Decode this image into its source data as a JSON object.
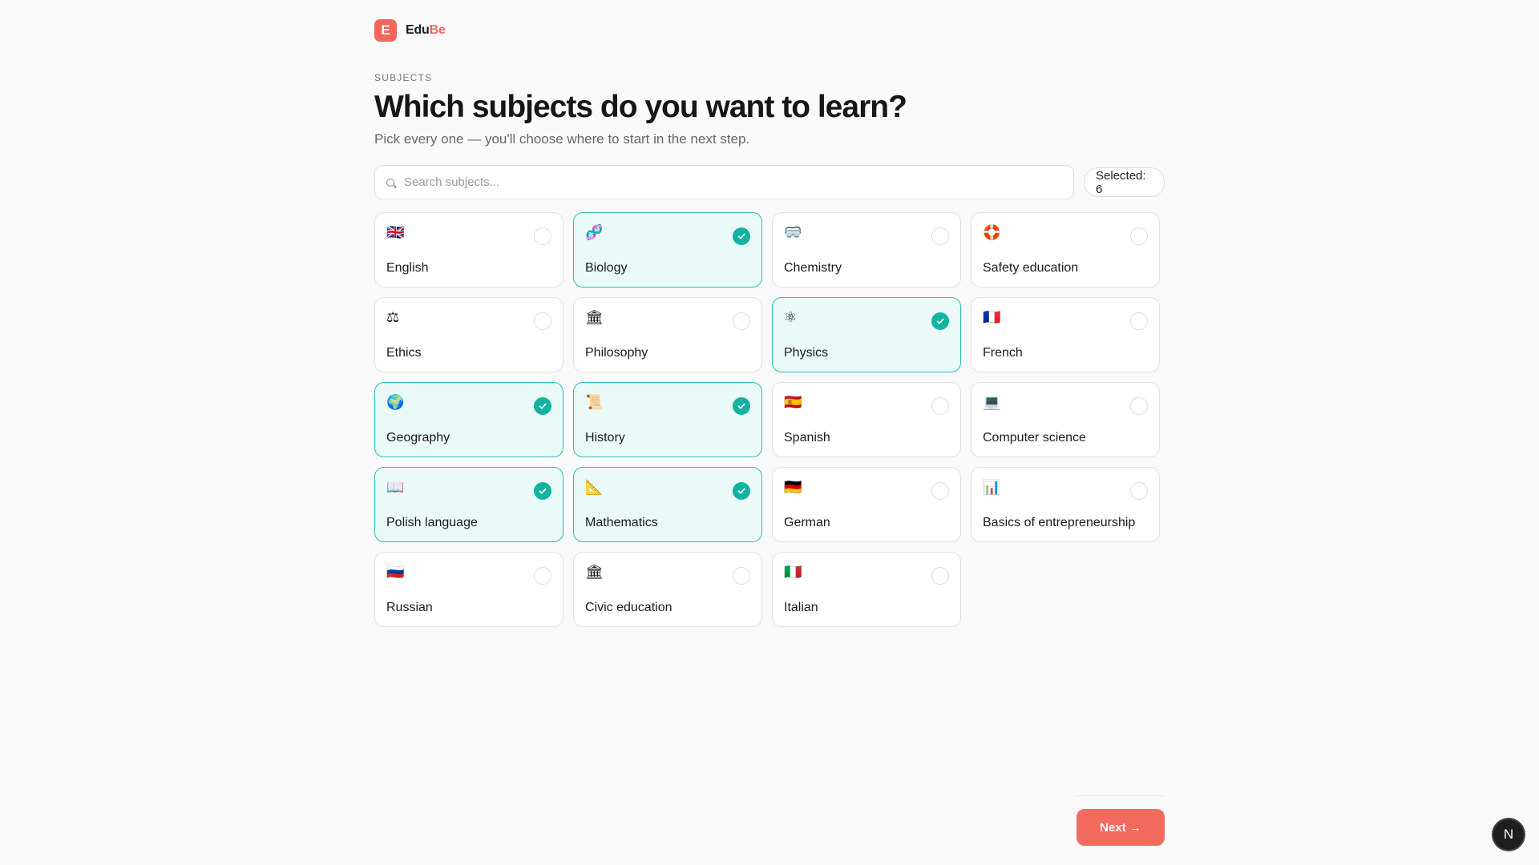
{
  "brand": {
    "logo_letter": "E",
    "name_main": "Edu",
    "name_accent": "Be",
    "accent_color": "#f0665a"
  },
  "header": {
    "eyebrow": "SUBJECTS",
    "title": "Which subjects do you want to learn?",
    "subtitle": "Pick every one — you'll choose where to start in the next step."
  },
  "search": {
    "placeholder": "Search subjects...",
    "value": "",
    "icon": "search-icon"
  },
  "selected_count": "Selected: 6",
  "subjects": [
    {
      "label": "English",
      "icon": "🇬🇧",
      "icon_name": "uk-flag-icon",
      "selected": false
    },
    {
      "label": "Biology",
      "icon": "🧬",
      "icon_name": "dna-icon",
      "selected": true
    },
    {
      "label": "Chemistry",
      "icon": "🥽",
      "icon_name": "goggles-icon",
      "selected": false
    },
    {
      "label": "Safety education",
      "icon": "🛟",
      "icon_name": "lifebuoy-icon",
      "selected": false
    },
    {
      "label": "Ethics",
      "icon": "⚖",
      "icon_name": "scales-icon",
      "selected": false
    },
    {
      "label": "Philosophy",
      "icon": "🏛",
      "icon_name": "classical-building-icon",
      "selected": false
    },
    {
      "label": "Physics",
      "icon": "⚛",
      "icon_name": "atom-icon",
      "selected": true
    },
    {
      "label": "French",
      "icon": "🇫🇷",
      "icon_name": "france-flag-icon",
      "selected": false
    },
    {
      "label": "Geography",
      "icon": "🌍",
      "icon_name": "globe-icon",
      "selected": true
    },
    {
      "label": "History",
      "icon": "📜",
      "icon_name": "scroll-icon",
      "selected": true
    },
    {
      "label": "Spanish",
      "icon": "🇪🇸",
      "icon_name": "spain-flag-icon",
      "selected": false
    },
    {
      "label": "Computer science",
      "icon": "💻",
      "icon_name": "laptop-icon",
      "selected": false
    },
    {
      "label": "Polish language",
      "icon": "📖",
      "icon_name": "open-book-icon",
      "selected": true
    },
    {
      "label": "Mathematics",
      "icon": "📐",
      "icon_name": "triangle-ruler-icon",
      "selected": true
    },
    {
      "label": "German",
      "icon": "🇩🇪",
      "icon_name": "germany-flag-icon",
      "selected": false
    },
    {
      "label": "Basics of entrepreneurship",
      "icon": "📊",
      "icon_name": "bar-chart-icon",
      "selected": false
    },
    {
      "label": "Russian",
      "icon": "🇷🇺",
      "icon_name": "russia-flag-icon",
      "selected": false
    },
    {
      "label": "Civic education",
      "icon": "🏛",
      "icon_name": "classical-building-icon",
      "selected": false
    },
    {
      "label": "Italian",
      "icon": "🇮🇹",
      "icon_name": "italy-flag-icon",
      "selected": false
    }
  ],
  "footer": {
    "next_label": "Next →"
  },
  "corner_badge": "N",
  "colors": {
    "selected_border": "#2bbfb0",
    "selected_bg": "#eafaf8",
    "check_fill": "#12b3a1",
    "next_button": "#f26b5e"
  }
}
